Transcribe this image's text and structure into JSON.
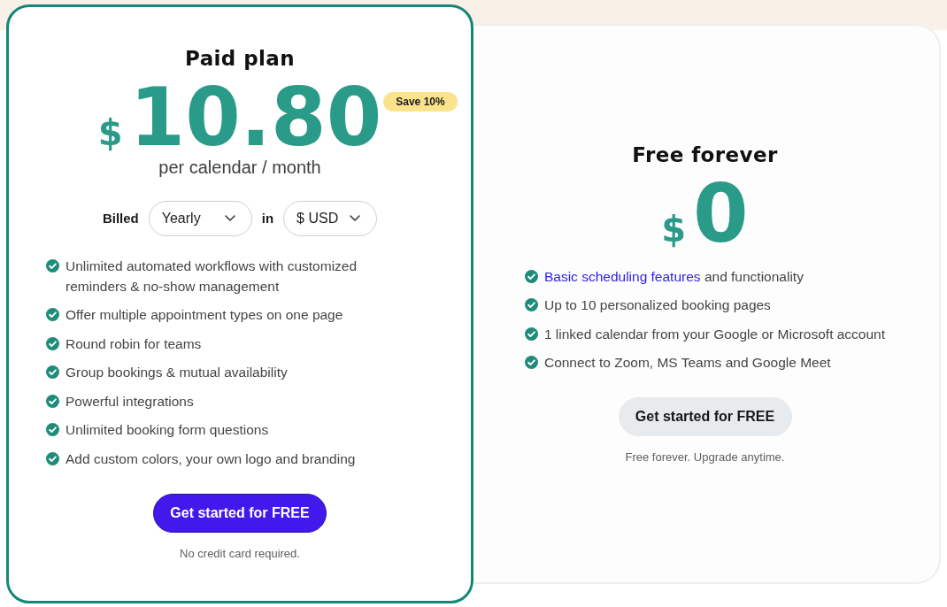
{
  "plans": [
    {
      "highlighted": true,
      "title": "Paid plan",
      "currency_symbol": "$",
      "amount": "10.80",
      "badge": "Save 10%",
      "period": "per calendar / month",
      "billing": {
        "label": "Billed",
        "period": "Yearly",
        "connector": "in",
        "currency": "$ USD"
      },
      "features": [
        {
          "text": "Unlimited automated workflows with customized reminders & no-show management"
        },
        {
          "text": "Offer multiple appointment types on one page"
        },
        {
          "text": "Round robin for teams"
        },
        {
          "text": "Group bookings & mutual availability"
        },
        {
          "text": "Powerful integrations"
        },
        {
          "text": "Unlimited booking form questions"
        },
        {
          "text": "Add custom colors, your own logo and branding"
        }
      ],
      "button": {
        "label": "Get started for FREE",
        "kind": "primary"
      },
      "note": "No credit card required."
    },
    {
      "highlighted": false,
      "title": "Free forever",
      "currency_symbol": "$",
      "amount": "0",
      "features": [
        {
          "link": "Basic scheduling features",
          "text": "and functionality"
        },
        {
          "text": "Up to 10 personalized booking pages"
        },
        {
          "text": "1 linked calendar from your Google or Microsoft account"
        },
        {
          "text": "Connect to Zoom, MS Teams and Google Meet"
        }
      ],
      "button": {
        "label": "Get started for FREE",
        "kind": "secondary"
      },
      "note": "Free forever. Upgrade anytime."
    }
  ]
}
